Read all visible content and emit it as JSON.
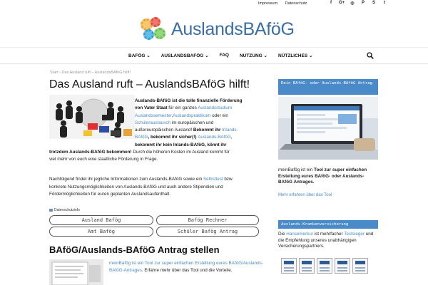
{
  "topbar": {
    "links": [
      "Impressum",
      "Datenschutz"
    ],
    "social": [
      {
        "icon": "facebook-icon",
        "glyph": "f"
      },
      {
        "icon": "google-plus-icon",
        "glyph": "G+"
      },
      {
        "icon": "instagram-icon",
        "glyph": "◎"
      },
      {
        "icon": "pinterest-icon",
        "glyph": "P"
      },
      {
        "icon": "skype-icon",
        "glyph": "S"
      },
      {
        "icon": "twitter-icon",
        "glyph": "t"
      }
    ]
  },
  "logo": {
    "text": "AuslandsBAföG",
    "gear_colors": [
      "#e8a13a",
      "#e24b3b",
      "#2f9fd6",
      "#6abf4b"
    ]
  },
  "nav": {
    "items": [
      "BAFÖG ⌄",
      "AUSLANDSBAFÖG ⌄",
      "FAQ",
      "NUTZUNG ⌄",
      "NÜTZLICHES ⌄"
    ],
    "search_icon": "search-icon"
  },
  "breadcrumb": "Start  › Das Ausland ruft – AuslandsBAföG hilft!",
  "page_title": "Das Ausland ruft – AuslandsBAföG hilft!",
  "intro": {
    "l1_bold": "Auslands-BAföG ist die tolle finanzielle Förderung",
    "l2_bold": "von Vater Staat",
    "l2_rest": " für ein ganzes ",
    "l2_link": "Auslandsstudium",
    "l3_link1": "Auslandssemester",
    "l3_sep": ",",
    "l3_link2": "Auslandspraktikum",
    "l3_rest": " oder ein",
    "l4_link": "Schüleraustausch",
    "l4_rest": " im europäischen und",
    "l5_text": "außereuropäischen Ausland! ",
    "l5_bold": "Bekommt ihr ",
    "l5_link": "Inlands-",
    "l6_link": "BAföG",
    "l6_bold": ", bekommt ihr sicher(!) ",
    "l6_link2": "Auslands-BAföG",
    "l6_end": ",",
    "l7_bold": "bekommt ihr kein Inlands-BAföG, könnt ihr",
    "l8_bold": "trotzdem Auslands-BAföG bekommen!",
    "l8_rest": " Durch die höheren Kosten im Ausland kommt für",
    "l9_text": "viel mehr von euch eine staatliche Förderung in Frage."
  },
  "para2": {
    "t1": "Nachfolgend findet ihr jegliche Informationen zum Auslands-BAföG sowie ein ",
    "link": "Selbsttest",
    "t2": " bzw.",
    "t3": "konkrete Nutzungsmöglichkeiten von Auslands-BAföG und auch andere Stipendien und",
    "t4": "Fördermöglichkeiten für euren geplanten Auslandsaufenthalt."
  },
  "privacy_label": "Datenschutzinfo",
  "buttons": [
    "Ausland Bafög",
    "Bafög Rechner",
    "Amt Bafög",
    "Schüler Bafög Antrag"
  ],
  "section2": {
    "title": "BAföG/Auslands-BAföG Antrag stellen",
    "text_link": "meinBafög ist ein Tool zur super einfachen Erstellung eures BAföG/Auslands-",
    "text_link2": "BAföG-Antrages",
    "text_rest": ". Erfahre mehr über das Tool und die Vorteile."
  },
  "sidebar": {
    "head1": "Dein BAföG- oder Auslands-BAföG Antrag",
    "text_pre": "meinBafög ist ein ",
    "text_bold": "Tool zur super einfachen Erstellung eures BAföG- oder Auslands-BAföG Antrages.",
    "more": "Mehr erfahren über das Tool",
    "head2": "Auslands-Krankenversicherung",
    "text2_pre": "Die ",
    "text2_link": "Hanse",
    "text2_mid": "merkur",
    "text2_rest": " ist mehrfacher ",
    "text2_link2": "Testsieger",
    "text2_end": " und die Empfehlung unseres unabhängigen Versicherungspartners."
  },
  "colors": {
    "accent": "#4a8ac9",
    "logo_text": "#3a6ea5"
  }
}
